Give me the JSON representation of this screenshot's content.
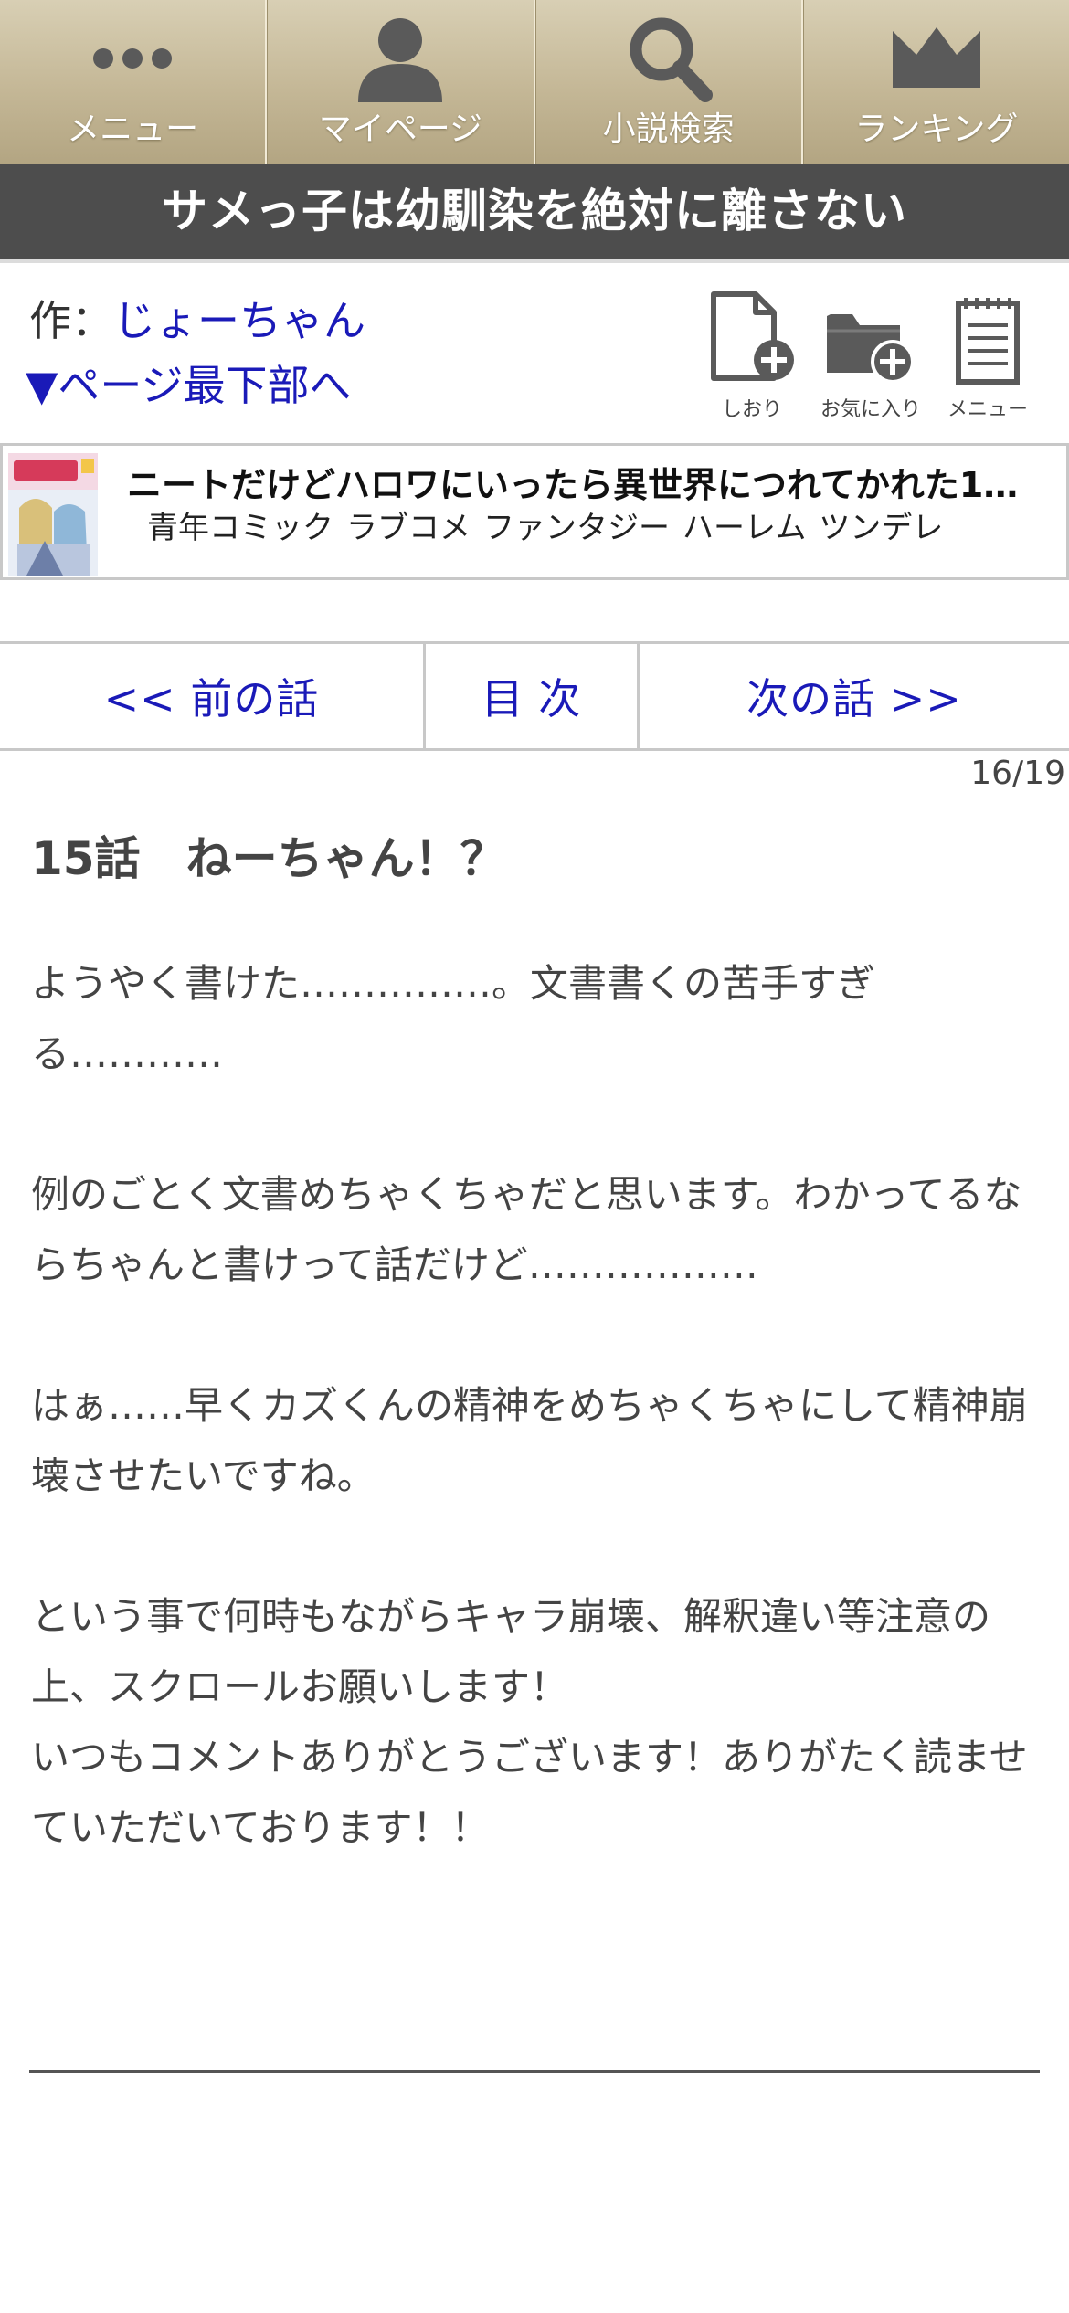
{
  "nav": {
    "menu_label": "メニュー",
    "mypage_label": "マイページ",
    "search_label": "小説検索",
    "ranking_label": "ランキング"
  },
  "novel": {
    "title": "サメっ子は幼馴染を絶対に離さない",
    "author_prefix": "作：",
    "author_name": "じょーちゃん",
    "jump_bottom": "▼ページ最下部へ"
  },
  "tools": {
    "bookmark_label": "しおり",
    "favorite_label": "お気に入り",
    "menu_label": "メニュー"
  },
  "ad": {
    "title": "ニートだけどハロワにいったら異世界につれてかれた1…",
    "tags": [
      "青年コミック",
      "ラブコメ",
      "ファンタジー",
      "ハーレム",
      "ツンデレ"
    ]
  },
  "episode_nav": {
    "prev": "<< 前の話",
    "toc": "目 次",
    "next": "次の話 >>"
  },
  "page_count": "16/19",
  "chapter": {
    "title": "15話　ねーちゃん！？",
    "paragraphs": [
      "ようやく書けた……………。文書書くの苦手すぎる…………",
      "",
      "例のごとく文書めちゃくちゃだと思います。わかってるならちゃんと書けって話だけど………………",
      "",
      "はぁ……早くカズくんの精神をめちゃくちゃにして精神崩壊させたいですね。",
      "",
      "という事で何時もながらキャラ崩壊、解釈違い等注意の上、スクロールお願いします！",
      "いつもコメントありがとうございます！ありがたく読ませていただいております！！"
    ]
  },
  "colors": {
    "nav_gradient_top": "#d8cfb4",
    "nav_gradient_bottom": "#b3a582",
    "title_bar": "#4d4d4d",
    "link": "#1a1ab8",
    "text": "#444444"
  }
}
